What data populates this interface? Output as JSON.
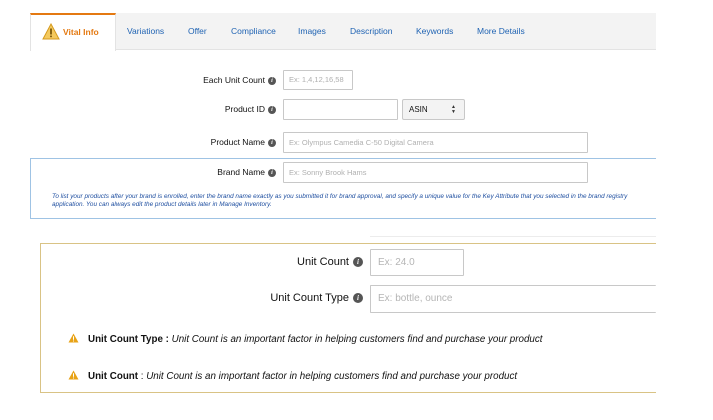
{
  "tabs": [
    {
      "label": "Vital Info",
      "active": true
    },
    {
      "label": "Variations"
    },
    {
      "label": "Offer"
    },
    {
      "label": "Compliance"
    },
    {
      "label": "Images"
    },
    {
      "label": "Description"
    },
    {
      "label": "Keywords"
    },
    {
      "label": "More Details"
    }
  ],
  "form": {
    "each_unit_count": {
      "label": "Each Unit Count",
      "placeholder": "Ex: 1,4,12,16,58",
      "value": ""
    },
    "product_id": {
      "label": "Product ID",
      "value": "",
      "type_selected": "ASIN"
    },
    "product_name": {
      "label": "Product Name",
      "placeholder": "Ex: Olympus Camedia C-50 Digital Camera",
      "value": ""
    },
    "brand_name": {
      "label": "Brand Name",
      "placeholder": "Ex: Sonny Brook Hams",
      "value": ""
    },
    "brand_note": "To list your products after your brand is enrolled, enter the brand name exactly as you submitted it for brand approval, and specify a unique value for the Key Attribute that you selected in the brand registry application. You can always edit the product details later in Manage Inventory."
  },
  "unit": {
    "unit_count": {
      "label": "Unit Count",
      "placeholder": "Ex: 24.0",
      "value": ""
    },
    "unit_count_type": {
      "label": "Unit Count Type",
      "placeholder": "Ex: bottle, ounce",
      "value": ""
    }
  },
  "warnings": [
    {
      "field": "Unit Count Type :",
      "message": "Unit Count is an important factor in helping customers find and purchase your product"
    },
    {
      "field": "Unit Count",
      "separator": " : ",
      "message": "Unit Count is an important factor in helping customers find and purchase your product"
    }
  ],
  "colors": {
    "accent": "#e47911",
    "link": "#1f63b3",
    "warning": "#e8a317",
    "note": "#1f4fa0"
  },
  "icons": {
    "info": "info-icon",
    "warning": "warning-triangle-icon",
    "select": "select-arrows-icon"
  }
}
